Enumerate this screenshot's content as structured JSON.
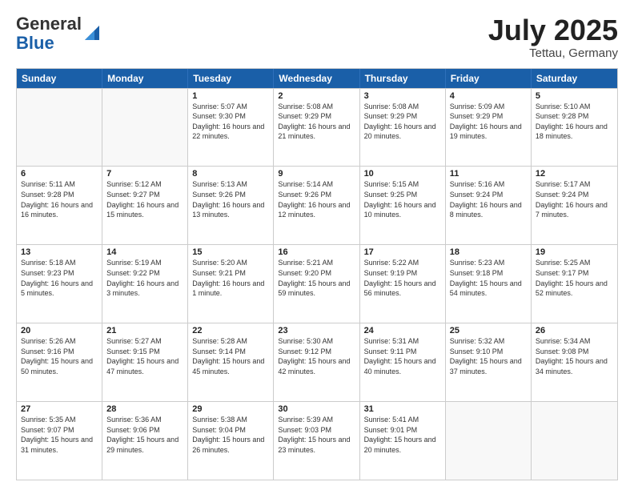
{
  "header": {
    "logo_general": "General",
    "logo_blue": "Blue",
    "month_year": "July 2025",
    "location": "Tettau, Germany"
  },
  "days_of_week": [
    "Sunday",
    "Monday",
    "Tuesday",
    "Wednesday",
    "Thursday",
    "Friday",
    "Saturday"
  ],
  "weeks": [
    [
      {
        "day": "",
        "sunrise": "",
        "sunset": "",
        "daylight": "",
        "empty": true
      },
      {
        "day": "",
        "sunrise": "",
        "sunset": "",
        "daylight": "",
        "empty": true
      },
      {
        "day": "1",
        "sunrise": "Sunrise: 5:07 AM",
        "sunset": "Sunset: 9:30 PM",
        "daylight": "Daylight: 16 hours and 22 minutes.",
        "empty": false
      },
      {
        "day": "2",
        "sunrise": "Sunrise: 5:08 AM",
        "sunset": "Sunset: 9:29 PM",
        "daylight": "Daylight: 16 hours and 21 minutes.",
        "empty": false
      },
      {
        "day": "3",
        "sunrise": "Sunrise: 5:08 AM",
        "sunset": "Sunset: 9:29 PM",
        "daylight": "Daylight: 16 hours and 20 minutes.",
        "empty": false
      },
      {
        "day": "4",
        "sunrise": "Sunrise: 5:09 AM",
        "sunset": "Sunset: 9:29 PM",
        "daylight": "Daylight: 16 hours and 19 minutes.",
        "empty": false
      },
      {
        "day": "5",
        "sunrise": "Sunrise: 5:10 AM",
        "sunset": "Sunset: 9:28 PM",
        "daylight": "Daylight: 16 hours and 18 minutes.",
        "empty": false
      }
    ],
    [
      {
        "day": "6",
        "sunrise": "Sunrise: 5:11 AM",
        "sunset": "Sunset: 9:28 PM",
        "daylight": "Daylight: 16 hours and 16 minutes.",
        "empty": false
      },
      {
        "day": "7",
        "sunrise": "Sunrise: 5:12 AM",
        "sunset": "Sunset: 9:27 PM",
        "daylight": "Daylight: 16 hours and 15 minutes.",
        "empty": false
      },
      {
        "day": "8",
        "sunrise": "Sunrise: 5:13 AM",
        "sunset": "Sunset: 9:26 PM",
        "daylight": "Daylight: 16 hours and 13 minutes.",
        "empty": false
      },
      {
        "day": "9",
        "sunrise": "Sunrise: 5:14 AM",
        "sunset": "Sunset: 9:26 PM",
        "daylight": "Daylight: 16 hours and 12 minutes.",
        "empty": false
      },
      {
        "day": "10",
        "sunrise": "Sunrise: 5:15 AM",
        "sunset": "Sunset: 9:25 PM",
        "daylight": "Daylight: 16 hours and 10 minutes.",
        "empty": false
      },
      {
        "day": "11",
        "sunrise": "Sunrise: 5:16 AM",
        "sunset": "Sunset: 9:24 PM",
        "daylight": "Daylight: 16 hours and 8 minutes.",
        "empty": false
      },
      {
        "day": "12",
        "sunrise": "Sunrise: 5:17 AM",
        "sunset": "Sunset: 9:24 PM",
        "daylight": "Daylight: 16 hours and 7 minutes.",
        "empty": false
      }
    ],
    [
      {
        "day": "13",
        "sunrise": "Sunrise: 5:18 AM",
        "sunset": "Sunset: 9:23 PM",
        "daylight": "Daylight: 16 hours and 5 minutes.",
        "empty": false
      },
      {
        "day": "14",
        "sunrise": "Sunrise: 5:19 AM",
        "sunset": "Sunset: 9:22 PM",
        "daylight": "Daylight: 16 hours and 3 minutes.",
        "empty": false
      },
      {
        "day": "15",
        "sunrise": "Sunrise: 5:20 AM",
        "sunset": "Sunset: 9:21 PM",
        "daylight": "Daylight: 16 hours and 1 minute.",
        "empty": false
      },
      {
        "day": "16",
        "sunrise": "Sunrise: 5:21 AM",
        "sunset": "Sunset: 9:20 PM",
        "daylight": "Daylight: 15 hours and 59 minutes.",
        "empty": false
      },
      {
        "day": "17",
        "sunrise": "Sunrise: 5:22 AM",
        "sunset": "Sunset: 9:19 PM",
        "daylight": "Daylight: 15 hours and 56 minutes.",
        "empty": false
      },
      {
        "day": "18",
        "sunrise": "Sunrise: 5:23 AM",
        "sunset": "Sunset: 9:18 PM",
        "daylight": "Daylight: 15 hours and 54 minutes.",
        "empty": false
      },
      {
        "day": "19",
        "sunrise": "Sunrise: 5:25 AM",
        "sunset": "Sunset: 9:17 PM",
        "daylight": "Daylight: 15 hours and 52 minutes.",
        "empty": false
      }
    ],
    [
      {
        "day": "20",
        "sunrise": "Sunrise: 5:26 AM",
        "sunset": "Sunset: 9:16 PM",
        "daylight": "Daylight: 15 hours and 50 minutes.",
        "empty": false
      },
      {
        "day": "21",
        "sunrise": "Sunrise: 5:27 AM",
        "sunset": "Sunset: 9:15 PM",
        "daylight": "Daylight: 15 hours and 47 minutes.",
        "empty": false
      },
      {
        "day": "22",
        "sunrise": "Sunrise: 5:28 AM",
        "sunset": "Sunset: 9:14 PM",
        "daylight": "Daylight: 15 hours and 45 minutes.",
        "empty": false
      },
      {
        "day": "23",
        "sunrise": "Sunrise: 5:30 AM",
        "sunset": "Sunset: 9:12 PM",
        "daylight": "Daylight: 15 hours and 42 minutes.",
        "empty": false
      },
      {
        "day": "24",
        "sunrise": "Sunrise: 5:31 AM",
        "sunset": "Sunset: 9:11 PM",
        "daylight": "Daylight: 15 hours and 40 minutes.",
        "empty": false
      },
      {
        "day": "25",
        "sunrise": "Sunrise: 5:32 AM",
        "sunset": "Sunset: 9:10 PM",
        "daylight": "Daylight: 15 hours and 37 minutes.",
        "empty": false
      },
      {
        "day": "26",
        "sunrise": "Sunrise: 5:34 AM",
        "sunset": "Sunset: 9:08 PM",
        "daylight": "Daylight: 15 hours and 34 minutes.",
        "empty": false
      }
    ],
    [
      {
        "day": "27",
        "sunrise": "Sunrise: 5:35 AM",
        "sunset": "Sunset: 9:07 PM",
        "daylight": "Daylight: 15 hours and 31 minutes.",
        "empty": false
      },
      {
        "day": "28",
        "sunrise": "Sunrise: 5:36 AM",
        "sunset": "Sunset: 9:06 PM",
        "daylight": "Daylight: 15 hours and 29 minutes.",
        "empty": false
      },
      {
        "day": "29",
        "sunrise": "Sunrise: 5:38 AM",
        "sunset": "Sunset: 9:04 PM",
        "daylight": "Daylight: 15 hours and 26 minutes.",
        "empty": false
      },
      {
        "day": "30",
        "sunrise": "Sunrise: 5:39 AM",
        "sunset": "Sunset: 9:03 PM",
        "daylight": "Daylight: 15 hours and 23 minutes.",
        "empty": false
      },
      {
        "day": "31",
        "sunrise": "Sunrise: 5:41 AM",
        "sunset": "Sunset: 9:01 PM",
        "daylight": "Daylight: 15 hours and 20 minutes.",
        "empty": false
      },
      {
        "day": "",
        "sunrise": "",
        "sunset": "",
        "daylight": "",
        "empty": true
      },
      {
        "day": "",
        "sunrise": "",
        "sunset": "",
        "daylight": "",
        "empty": true
      }
    ]
  ]
}
